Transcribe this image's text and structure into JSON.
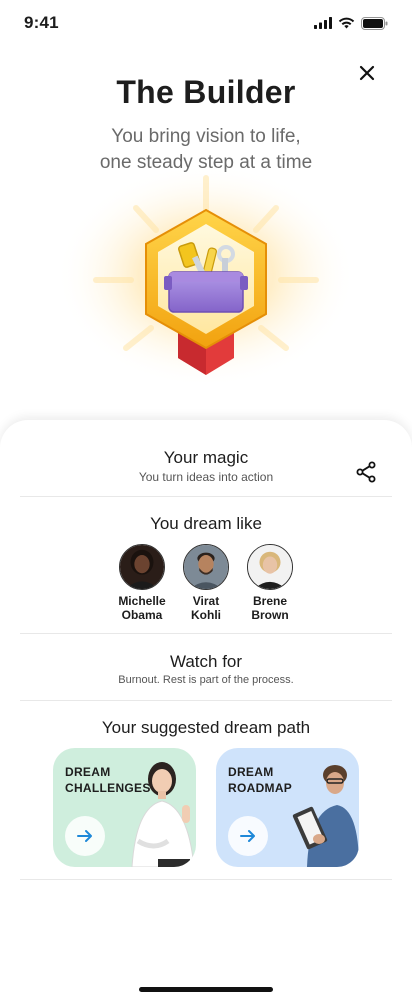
{
  "status": {
    "time": "9:41"
  },
  "hero": {
    "title": "The Builder",
    "subtitle_line1": "You bring vision to life,",
    "subtitle_line2": "one steady step at a time",
    "badge_icon": "toolbox-badge-icon"
  },
  "magic": {
    "title": "Your magic",
    "subtitle": "You turn ideas into action"
  },
  "dream_like": {
    "title": "You dream like",
    "people": [
      {
        "first": "Michelle",
        "last": "Obama"
      },
      {
        "first": "Virat",
        "last": "Kohli"
      },
      {
        "first": "Brene",
        "last": "Brown"
      }
    ]
  },
  "watch_for": {
    "title": "Watch for",
    "subtitle": "Burnout. Rest is part of the process."
  },
  "dream_path": {
    "title": "Your suggested dream path",
    "cards": [
      {
        "line1": "DREAM",
        "line2": "CHALLENGES",
        "color": "#cfeedd"
      },
      {
        "line1": "DREAM",
        "line2": "ROADMAP",
        "color": "#cfe3fb"
      }
    ]
  },
  "colors": {
    "accent_blue": "#1e88d8",
    "badge_gold": "#f5b21a",
    "badge_red": "#e23b3b",
    "toolbox_purple": "#9c7fd6"
  }
}
